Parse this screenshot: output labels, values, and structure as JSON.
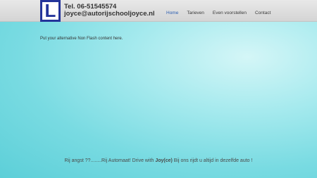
{
  "logo": {
    "letter": "L"
  },
  "contact": {
    "phone": "Tel. 06-51545574",
    "email": "joyce@autorijschooljoyce.nl"
  },
  "nav": {
    "items": [
      {
        "label": "Home"
      },
      {
        "label": "Tarieven"
      },
      {
        "label": "Even voorstellen"
      },
      {
        "label": "Contact"
      }
    ],
    "active_color": "#2b5db0"
  },
  "main": {
    "alt_content": "Put your alternative Non Flash content here."
  },
  "footer": {
    "tagline_before": "Rij angst ??........Rij Automaat! Drive with ",
    "tagline_bold": "Joy(ce)",
    "tagline_after": " Bij ons rijdt u altijd in dezelfde auto !"
  },
  "colors": {
    "logo_blue": "#24349a",
    "background_teal": "#79dbe2"
  }
}
